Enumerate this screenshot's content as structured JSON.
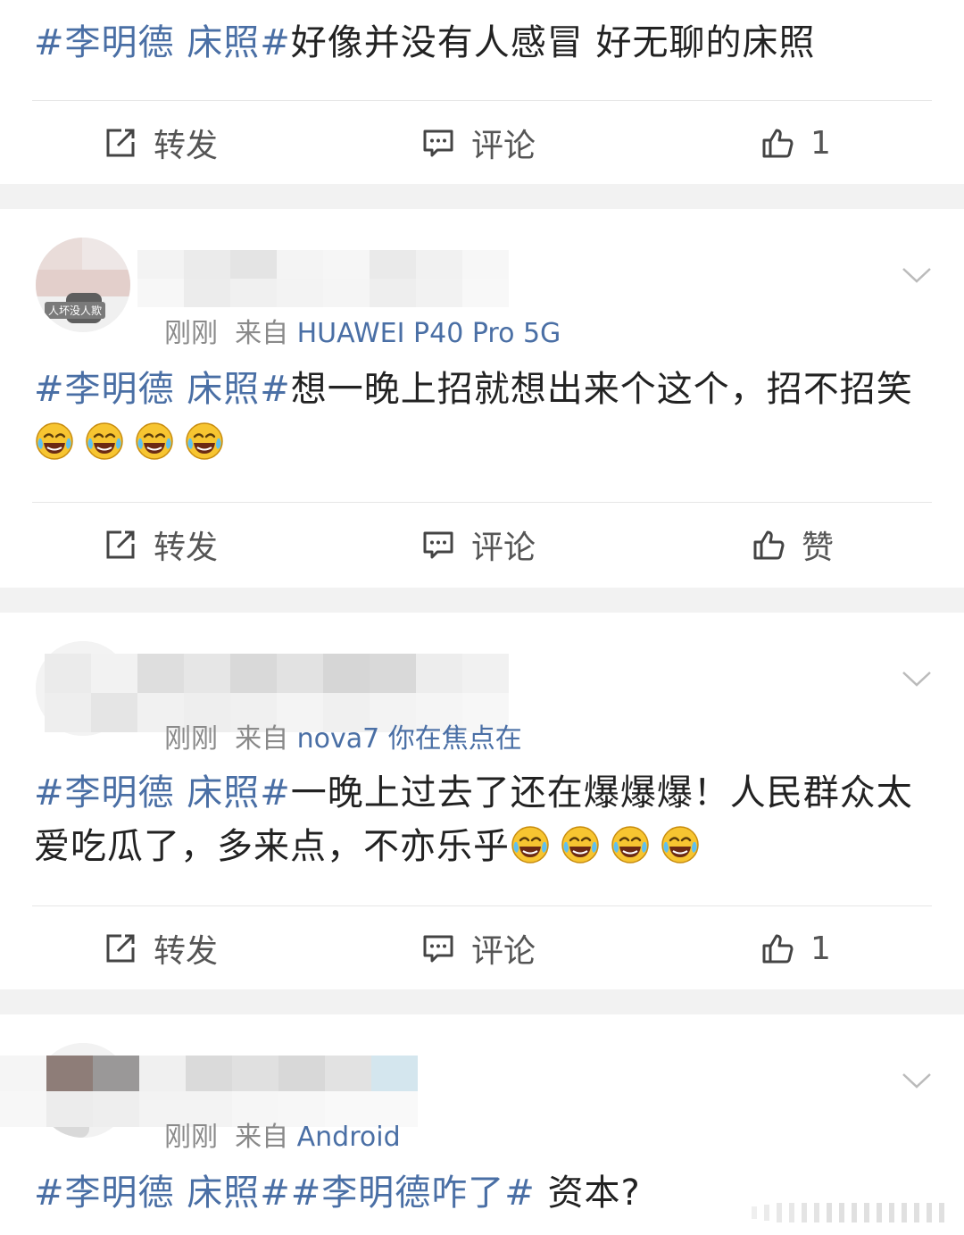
{
  "posts": [
    {
      "text": {
        "hashtag": "#李明德 床照#",
        "content": "好像并没有人感冒 好无聊的床照"
      },
      "actions": {
        "repost": "转发",
        "comment": "评论",
        "like": "1"
      }
    },
    {
      "meta": {
        "time": "刚刚",
        "source_prefix": "来自",
        "source": "HUAWEI P40 Pro 5G"
      },
      "avatar_tag": "人坏没人欺",
      "text": {
        "hashtag": "#李明德 床照#",
        "content": "想一晚上招就想出来个这个，招不招笑",
        "emoji": "laugh-cry-emoji",
        "emoji_count": 4
      },
      "actions": {
        "repost": "转发",
        "comment": "评论",
        "like": "赞"
      }
    },
    {
      "meta": {
        "time": "刚刚",
        "source_prefix": "来自",
        "source": "nova7 你在焦点在"
      },
      "text": {
        "hashtag": "#李明德 床照#",
        "content": "一晚上过去了还在爆爆爆！人民群众太爱吃瓜了，多来点，不亦乐乎",
        "emoji": "laugh-cry-emoji",
        "emoji_count": 4
      },
      "actions": {
        "repost": "转发",
        "comment": "评论",
        "like": "1"
      }
    },
    {
      "meta": {
        "time": "刚刚",
        "source_prefix": "来自",
        "source": "Android"
      },
      "text": {
        "hashtag": "#李明德 床照##李明德咋了#",
        "content": " 资本?"
      }
    }
  ],
  "icons": {
    "repost": "repost-icon",
    "comment": "comment-icon",
    "like": "thumbs-up-icon",
    "more": "chevron-down-icon"
  },
  "colors": {
    "hashtag": "#4a6fa5",
    "text": "#222222",
    "meta": "#8a8a8a",
    "action": "#555555",
    "separator": "#f2f2f2",
    "emoji_face": "#f7c531"
  }
}
